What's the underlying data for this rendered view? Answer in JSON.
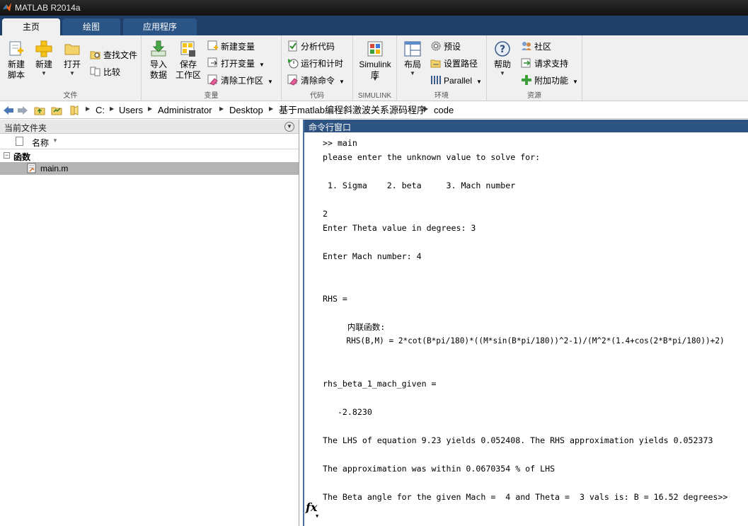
{
  "window": {
    "title": "MATLAB R2014a"
  },
  "tabs": [
    {
      "label": "主页"
    },
    {
      "label": "绘图"
    },
    {
      "label": "应用程序"
    }
  ],
  "ribbon": {
    "file_group": {
      "label": "文件",
      "new_script": "新建\n脚本",
      "new": "新建",
      "open": "打开",
      "find_files": "查找文件",
      "compare": "比较"
    },
    "variable_group": {
      "label": "变量",
      "import_data": "导入\n数据",
      "save_workspace": "保存\n工作区",
      "new_variable": "新建变量",
      "open_variable": "打开变量",
      "clear_workspace": "清除工作区"
    },
    "code_group": {
      "label": "代码",
      "analyze_code": "分析代码",
      "run_and_time": "运行和计时",
      "clear_commands": "清除命令"
    },
    "simulink_group": {
      "label": "SIMULINK",
      "library": "Simulink\n库"
    },
    "environment_group": {
      "label": "环境",
      "layout": "布局",
      "preferences": "预设",
      "set_path": "设置路径",
      "parallel": "Parallel"
    },
    "resources_group": {
      "label": "资源",
      "help": "帮助",
      "community": "社区",
      "request_support": "请求支持",
      "add_ons": "附加功能"
    }
  },
  "address": {
    "crumbs": [
      "C:",
      "Users",
      "Administrator",
      "Desktop",
      "基于matlab编程斜激波关系源码程序",
      "code"
    ]
  },
  "current_folder": {
    "title": "当前文件夹",
    "column_name": "名称",
    "group_label": "函数",
    "files": [
      "main.m"
    ]
  },
  "command_window": {
    "title": "命令行窗口",
    "lines": [
      ">> main",
      "please enter the unknown value to solve for:",
      "",
      " 1. Sigma    2. beta     3. Mach number",
      "",
      "2",
      "Enter Theta value in degrees: 3",
      "",
      "Enter Mach number: 4",
      "",
      "",
      "RHS =",
      "",
      "     内联函数:",
      "     RHS(B,M) = 2*cot(B*pi/180)*((M*sin(B*pi/180))^2-1)/(M^2*(1.4+cos(2*B*pi/180))+2)",
      "",
      "",
      "rhs_beta_1_mach_given =",
      "",
      "   -2.8230",
      "",
      "The LHS of equation 9.23 yields 0.052408. The RHS approximation yields 0.052373",
      "",
      "The approximation was within 0.0670354 % of LHS",
      "",
      "The Beta angle for the given Mach =  4 and Theta =  3 vals is: B = 16.52 degrees>>"
    ],
    "fx_label": "fx"
  }
}
